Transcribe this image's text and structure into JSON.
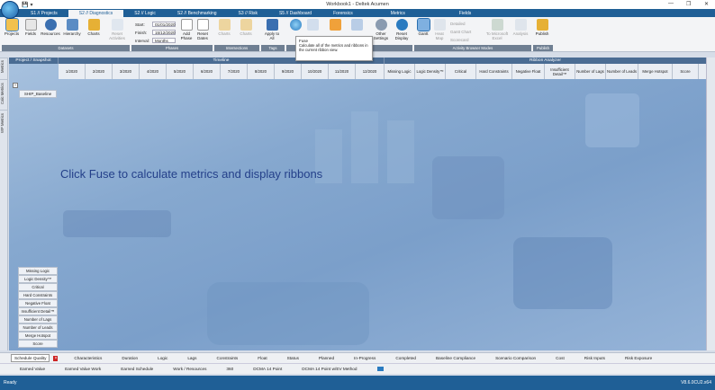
{
  "window": {
    "title": "Workbook1 - Deltek Acumen"
  },
  "menu": {
    "tabs": [
      "S1 // Projects",
      "S2 // Diagnostics",
      "S2 // Logic",
      "S2 // Benchmarking",
      "S3 // Risk",
      "S5 // Dashboard",
      "Forensics",
      "Metrics",
      "Fields"
    ],
    "active": "S2 // Diagnostics"
  },
  "ribbon": {
    "projects": "Projects",
    "fields": "Fields",
    "resources": "Resources",
    "hierarchy": "Hierarchy",
    "charts": "Charts",
    "group_datasets": "Datasets",
    "date_fields": {
      "start_label": "Start:",
      "start_value": "01/01/2020",
      "finish_label": "Finish:",
      "finish_value": "15/12/2020",
      "interval_label": "Interval:",
      "interval_value": "Months"
    },
    "reset_activities": "Reset Activities",
    "add_phase": "Add Phase",
    "reset_dates": "Reset Dates",
    "group_phases": "Phases",
    "charts2": "Charts",
    "charts3": "Charts",
    "group_intersections": "Intersections",
    "apply_to_all": "Apply to All",
    "group_tags": "Tags",
    "fuse": "Fuse",
    "other_settings": "Other Settings",
    "reset_display": "Reset Display",
    "group_display": "Display Settings",
    "gantt": "Gantt",
    "heat_map": "Heat Map",
    "detailed": "Detailed",
    "gantt_chart": "Gantt Chart",
    "scorecard": "Scorecard",
    "to_excel": "To Microsoft Excel",
    "analysis": "Analysis",
    "group_browse": "Activity Browser Modes",
    "publish": "Publish",
    "group_publish": "Publish"
  },
  "tooltip": {
    "title": "Fuse",
    "body": "Calculate all of the metrics and ribbons in the current ribbon view."
  },
  "lefttabs": [
    "Metrics",
    "Calc Metrics",
    "WP Metrics"
  ],
  "grid": {
    "project_header": "Project / Snapshot",
    "timeline_header": "Timeline",
    "ribbon_header": "Ribbon Analyzer",
    "months": [
      "1/2020",
      "2/2020",
      "3/2020",
      "4/2020",
      "5/2020",
      "6/2020",
      "7/2020",
      "8/2020",
      "9/2020",
      "10/2020",
      "11/2020",
      "12/2020"
    ],
    "metrics": [
      "Missing Logic",
      "Logic Density™",
      "Critical",
      "Hard Constraints",
      "Negative Float",
      "Insufficient Detail™",
      "Number of Lags",
      "Number of Leads",
      "Merge Hotspot",
      "Score"
    ],
    "snapshot": "SHIP_Baseline",
    "expand": "+",
    "row_labels": [
      "Missing Logic",
      "Logic Density™",
      "Critical",
      "Hard Constraints",
      "Negative Float",
      "Insufficient Detail™",
      "Number of Lags",
      "Number of Leads",
      "Merge Hotspot",
      "Score"
    ]
  },
  "message": "Click Fuse to calculate metrics and display ribbons",
  "bottom_tabs": [
    "Schedule Quality",
    "Characteristics",
    "Duration",
    "Logic",
    "Lags",
    "Constraints",
    "Float",
    "Status",
    "Planned",
    "In-Progress",
    "Completed",
    "Baseline Compliance",
    "Scenario Comparison",
    "Cost",
    "Risk Inputs",
    "Risk Exposure"
  ],
  "sub_tabs": [
    "Earned Value",
    "Earned Value Work",
    "Earned Schedule",
    "Work / Resources",
    "360",
    "DCMA 14 Point",
    "DCMA 14 Point w/EV Method"
  ],
  "status": {
    "left": "Ready",
    "right": "V8.6.0CU2.x64"
  },
  "colors": {
    "titlebar": "#1f5f96",
    "ribbon_header": "#4a6c93",
    "message": "#24408a"
  }
}
